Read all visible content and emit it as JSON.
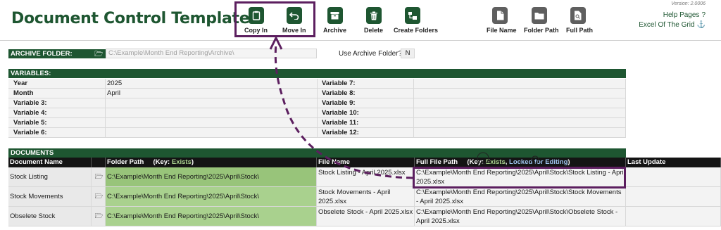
{
  "title": "Document Control Template",
  "toolbar": [
    {
      "label": "Copy In",
      "icon": "clipboard-icon",
      "style": "green",
      "left": 0
    },
    {
      "label": "Move In",
      "icon": "undo-arrow-icon",
      "style": "green"
    },
    {
      "label": "Archive",
      "icon": "archive-box-icon",
      "style": "green"
    },
    {
      "label": "Delete",
      "icon": "trash-icon",
      "style": "green"
    },
    {
      "label": "Create Folders",
      "icon": "folders-icon",
      "style": "green"
    },
    {
      "label": "File Name",
      "icon": "file-icon",
      "style": "grey"
    },
    {
      "label": "Folder Path",
      "icon": "folder-icon",
      "style": "grey"
    },
    {
      "label": "Full Path",
      "icon": "file-search-icon",
      "style": "grey"
    }
  ],
  "version": "Version: 2.0006",
  "help_pages": "Help Pages",
  "excel_of_the_grid": "Excel Of The Grid",
  "archive": {
    "label": "ARCHIVE FOLDER:",
    "path": "C:\\Example\\Month End Reporting\\Archive\\",
    "use_label": "Use Archive Folder?",
    "use_value": "N"
  },
  "variables": {
    "header": "VARIABLES:",
    "rows": [
      {
        "l1": "Year",
        "v1": "2025",
        "l2": "Variable 7:",
        "v2": ""
      },
      {
        "l1": "Month",
        "v1": "April",
        "l2": "Variable 8:",
        "v2": ""
      },
      {
        "l1": "Variable 3:",
        "v1": "",
        "l2": "Variable 9:",
        "v2": ""
      },
      {
        "l1": "Variable 4:",
        "v1": "",
        "l2": "Variable 10:",
        "v2": ""
      },
      {
        "l1": "Variable 5:",
        "v1": "",
        "l2": "Variable 11:",
        "v2": ""
      },
      {
        "l1": "Variable 6:",
        "v1": "",
        "l2": "Variable 12:",
        "v2": ""
      }
    ]
  },
  "documents": {
    "header": "DOCUMENTS",
    "columns": {
      "name": "Document Name",
      "folder": "Folder Path",
      "folder_key_prefix": "(Key: ",
      "folder_key_exists": "Exists",
      "folder_key_suffix": ")",
      "file": "File Name",
      "full": "Full File Path",
      "full_key_prefix": "(Key: ",
      "full_key_exists": "Exists",
      "full_key_sep": ", ",
      "full_key_locked": "Locked for Editing",
      "full_key_suffix": ")",
      "last": "Last Update"
    },
    "rows": [
      {
        "name": "Stock Listing",
        "folder": "C:\\Example\\Month End Reporting\\2025\\April\\Stock\\",
        "file": "Stock Listing - April 2025.xlsx",
        "full": "C:\\Example\\Month End Reporting\\2025\\April\\Stock\\Stock Listing - April 2025.xlsx",
        "last": ""
      },
      {
        "name": "Stock Movements",
        "folder": "C:\\Example\\Month End Reporting\\2025\\April\\Stock\\",
        "file": "Stock Movements - April 2025.xlsx",
        "full": "C:\\Example\\Month End Reporting\\2025\\April\\Stock\\Stock Movements - April 2025.xlsx",
        "last": ""
      },
      {
        "name": "Obselete Stock",
        "folder": "C:\\Example\\Month End Reporting\\2025\\April\\Stock\\",
        "file": "Obselete Stock - April 2025.xlsx",
        "full": "C:\\Example\\Month End Reporting\\2025\\April\\Stock\\Obselete Stock - April 2025.xlsx",
        "last": ""
      }
    ]
  },
  "colors": {
    "brand_green": "#1e5631",
    "exists_green": "#a9d18e",
    "highlight_purple": "#5c1f5f",
    "locked_blue": "#9fc3ee"
  }
}
